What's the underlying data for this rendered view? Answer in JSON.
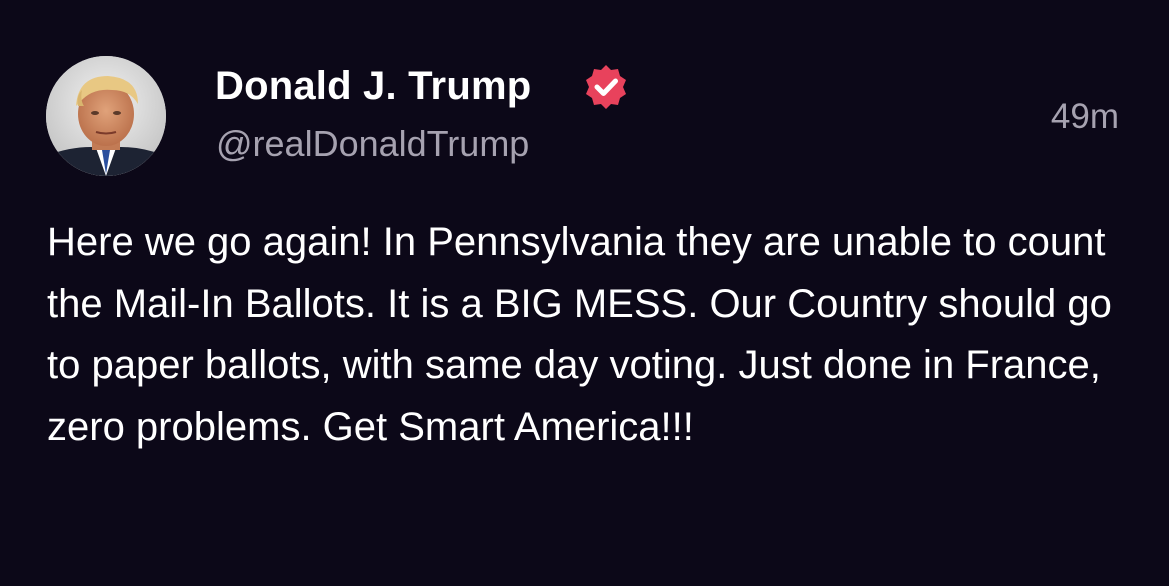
{
  "post": {
    "author": {
      "name": "Donald J. Trump",
      "handle": "@realDonaldTrump",
      "verified": true,
      "avatar_icon": "profile-photo-avatar"
    },
    "timestamp": "49m",
    "body": "Here we go again! In Pennsylvania they are unable to count the Mail-In Ballots. It is a BIG MESS. Our Country should go to paper ballots, with same day voting. Just done in France, zero problems. Get Smart America!!!"
  },
  "colors": {
    "background": "#0c0818",
    "primary_text": "#ffffff",
    "secondary_text": "#a6a2b0",
    "verified_badge": "#e8425c"
  },
  "icons": {
    "verified": "verified-badge-icon"
  }
}
